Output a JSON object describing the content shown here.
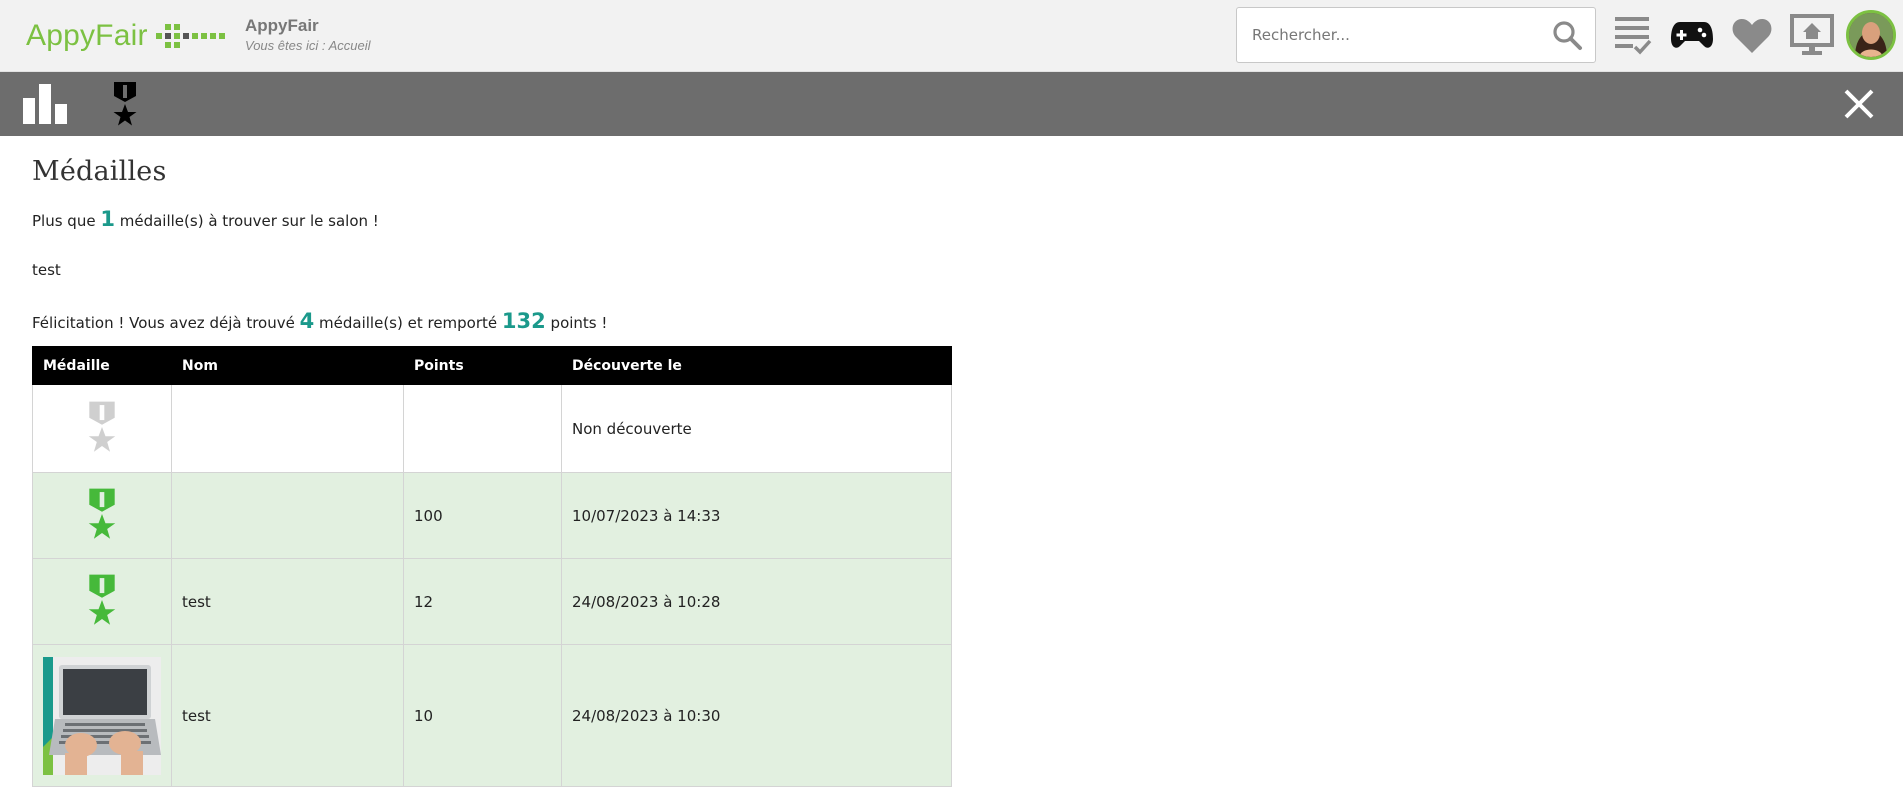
{
  "header": {
    "logo_text": "AppyFair",
    "site_name": "AppyFair",
    "breadcrumb": "Vous êtes ici : Accueil",
    "search_placeholder": "Rechercher..."
  },
  "colors": {
    "brand_green": "#7cc142",
    "accent_teal": "#1b998b",
    "subbar_grey": "#6d6d6d",
    "row_found": "#e2f0e0"
  },
  "page": {
    "title": "Médailles",
    "remaining_prefix": "Plus que",
    "remaining_count": "1",
    "remaining_suffix": "médaille(s) à trouver sur le salon !",
    "note": "test",
    "congrats_prefix": "Félicitation ! Vous avez déjà trouvé",
    "found_count": "4",
    "congrats_mid": "médaille(s) et remporté",
    "points_total": "132",
    "congrats_suffix": "points !"
  },
  "table": {
    "headers": [
      "Médaille",
      "Nom",
      "Points",
      "Découverte le"
    ],
    "rows": [
      {
        "medal": "grey-medal-icon",
        "name": "",
        "points": "",
        "date": "Non découverte"
      },
      {
        "medal": "green-medal-icon",
        "name": "",
        "points": "100",
        "date": "10/07/2023 à 14:33"
      },
      {
        "medal": "green-medal-icon",
        "name": "test",
        "points": "12",
        "date": "24/08/2023 à 10:28"
      },
      {
        "medal": "laptop-photo",
        "name": "test",
        "points": "10",
        "date": "24/08/2023 à 10:30"
      }
    ]
  }
}
